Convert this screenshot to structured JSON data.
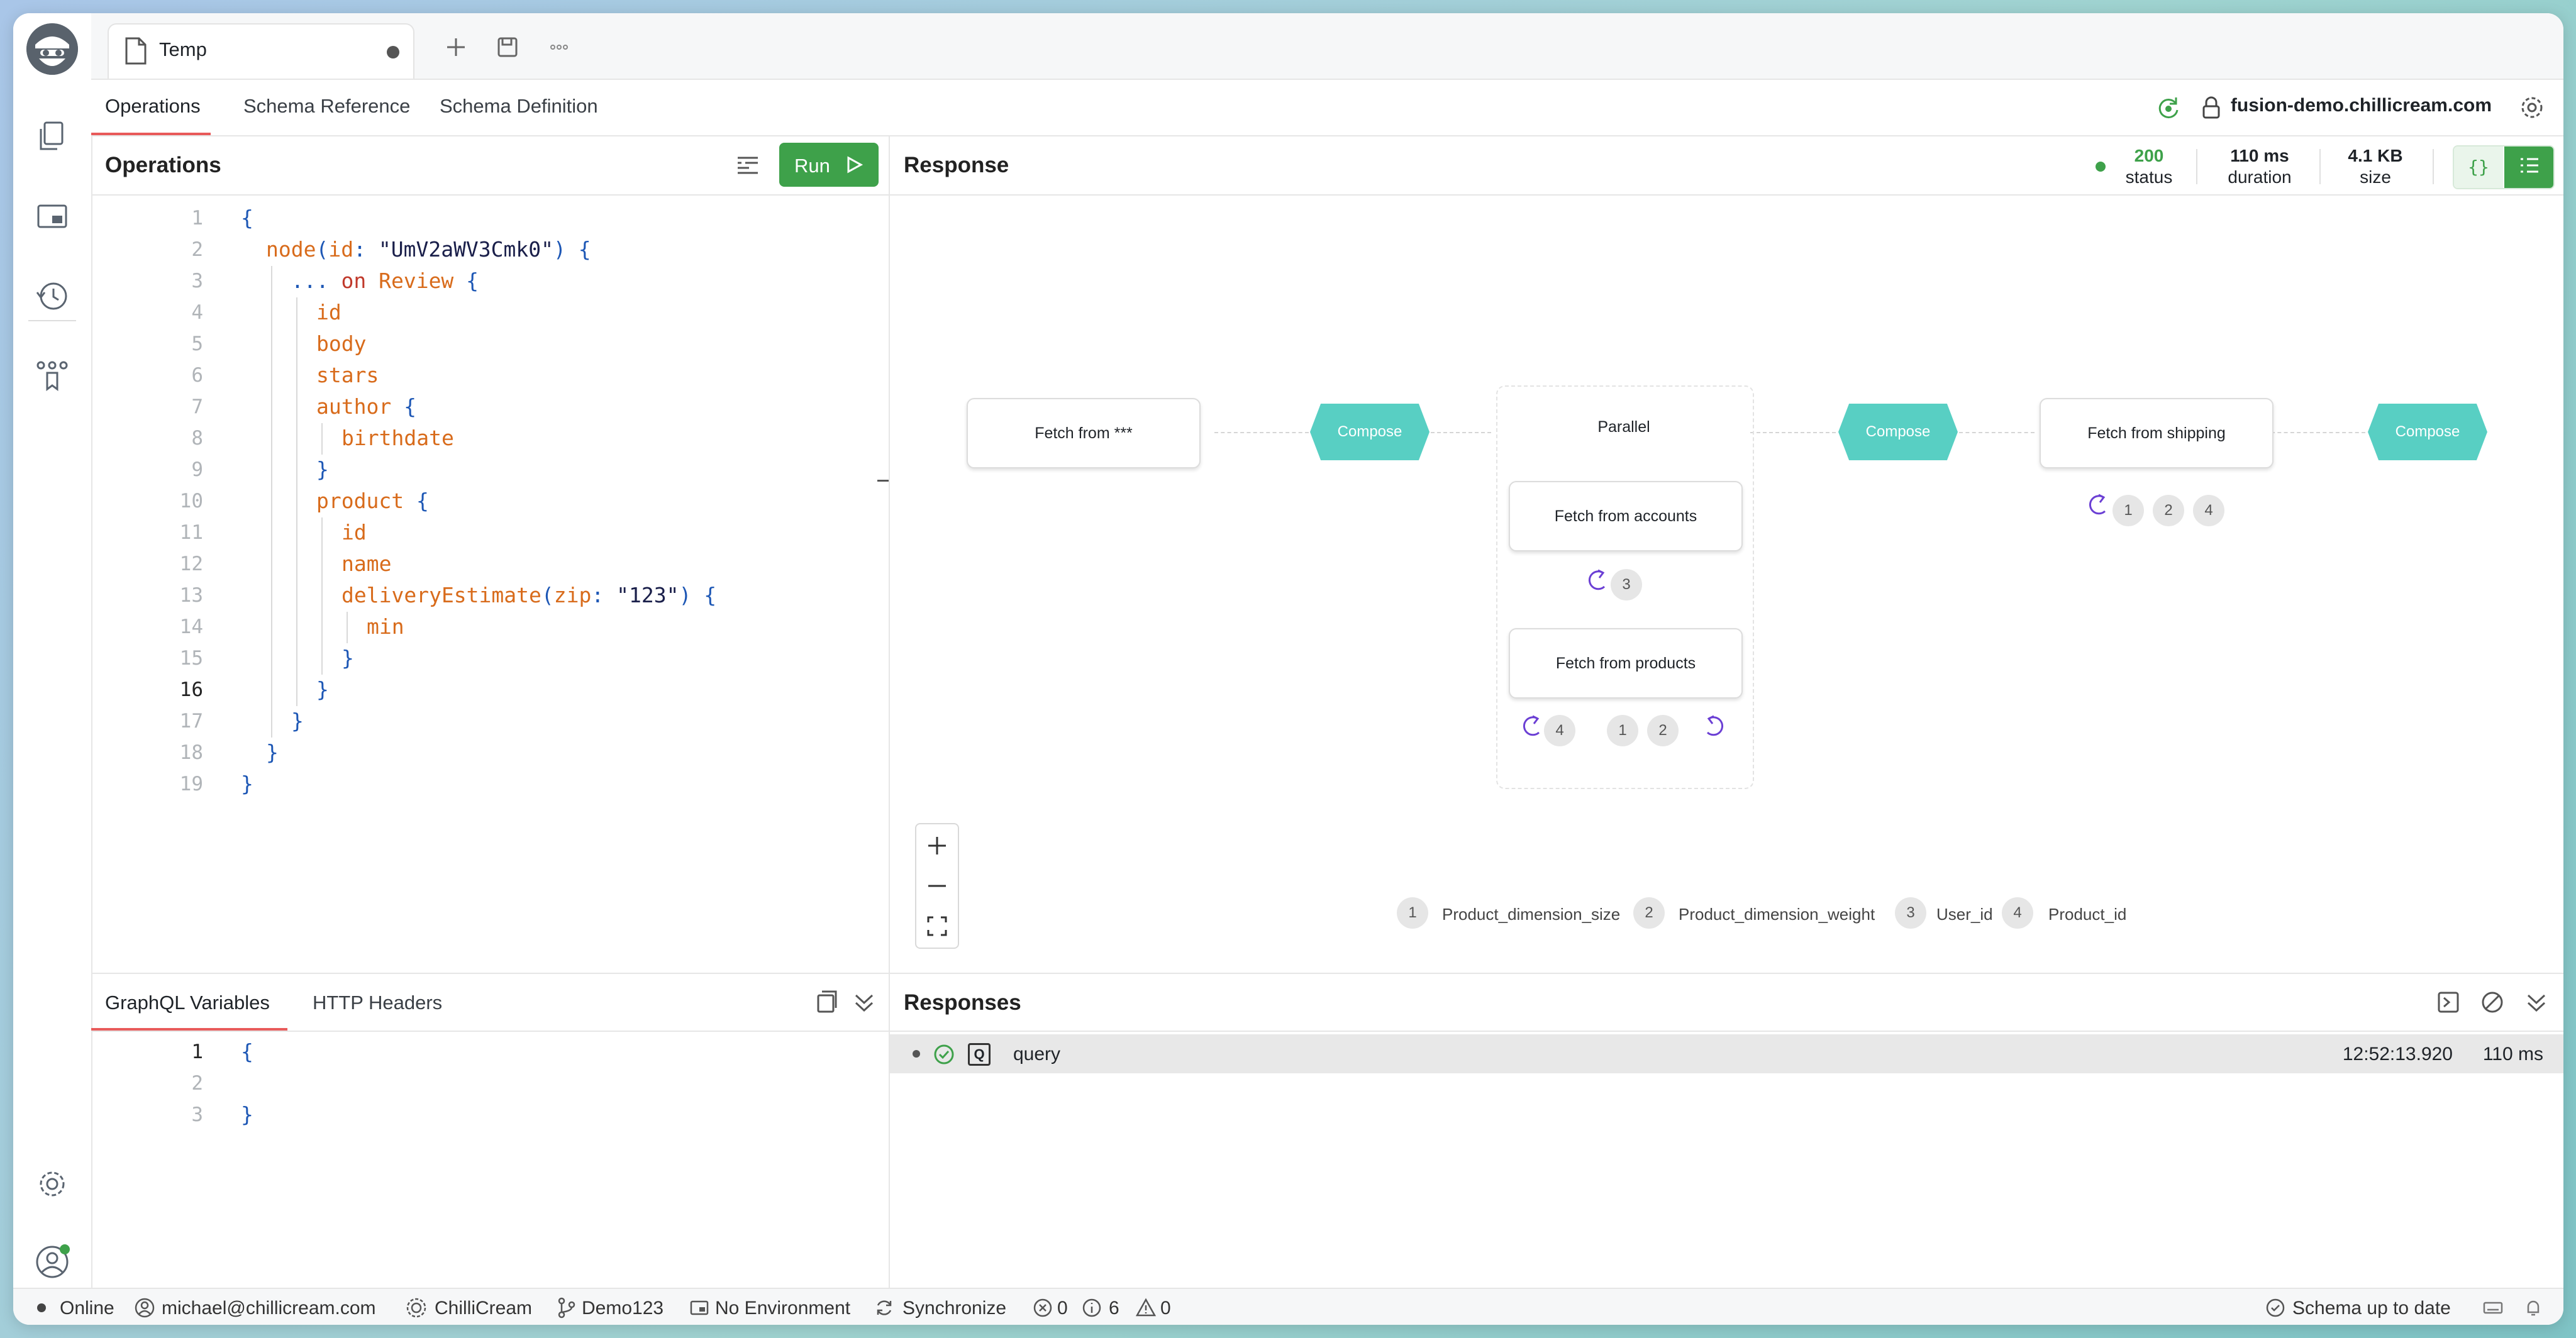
{
  "colors": {
    "accent": "#3ea14a",
    "tab_underline": "#e85a5a",
    "compose": "#58cfc3",
    "keyword_blue": "#1d57b5",
    "field_orange": "#d86b1b",
    "arrow_purple": "#6b3fd4"
  },
  "tab": {
    "title": "Temp"
  },
  "subtabs": [
    "Operations",
    "Schema Reference",
    "Schema Definition"
  ],
  "endpoint": "fusion-demo.chillicream.com",
  "operations": {
    "title": "Operations",
    "run_label": "Run",
    "lines": [
      {
        "n": "1",
        "i": 0,
        "parts": [
          [
            "{",
            "br"
          ]
        ]
      },
      {
        "n": "2",
        "i": 1,
        "parts": [
          [
            "node",
            "fn"
          ],
          [
            "(",
            "br"
          ],
          [
            "id",
            "fn"
          ],
          [
            ": ",
            "br"
          ],
          [
            "\"UmV2aWV3Cmk0\"",
            "str"
          ],
          [
            ") {",
            "br"
          ]
        ]
      },
      {
        "n": "3",
        "i": 2,
        "parts": [
          [
            "... ",
            "br"
          ],
          [
            "on ",
            "kw"
          ],
          [
            "Review ",
            "ty"
          ],
          [
            "{",
            "br"
          ]
        ]
      },
      {
        "n": "4",
        "i": 3,
        "parts": [
          [
            "id",
            "fn"
          ]
        ]
      },
      {
        "n": "5",
        "i": 3,
        "parts": [
          [
            "body",
            "fn"
          ]
        ]
      },
      {
        "n": "6",
        "i": 3,
        "parts": [
          [
            "stars",
            "fn"
          ]
        ]
      },
      {
        "n": "7",
        "i": 3,
        "parts": [
          [
            "author ",
            "fn"
          ],
          [
            "{",
            "br"
          ]
        ]
      },
      {
        "n": "8",
        "i": 4,
        "parts": [
          [
            "birthdate",
            "fn"
          ]
        ]
      },
      {
        "n": "9",
        "i": 3,
        "parts": [
          [
            "}",
            "br"
          ]
        ]
      },
      {
        "n": "10",
        "i": 3,
        "parts": [
          [
            "product ",
            "fn"
          ],
          [
            "{",
            "br"
          ]
        ]
      },
      {
        "n": "11",
        "i": 4,
        "parts": [
          [
            "id",
            "fn"
          ]
        ]
      },
      {
        "n": "12",
        "i": 4,
        "parts": [
          [
            "name",
            "fn"
          ]
        ]
      },
      {
        "n": "13",
        "i": 4,
        "parts": [
          [
            "deliveryEstimate",
            "fn"
          ],
          [
            "(",
            "br"
          ],
          [
            "zip",
            "fn"
          ],
          [
            ": ",
            "br"
          ],
          [
            "\"123\"",
            "str"
          ],
          [
            ") {",
            "br"
          ]
        ]
      },
      {
        "n": "14",
        "i": 5,
        "parts": [
          [
            "min",
            "fn"
          ]
        ]
      },
      {
        "n": "15",
        "i": 4,
        "parts": [
          [
            "}",
            "br"
          ]
        ]
      },
      {
        "n": "16",
        "i": 3,
        "parts": [
          [
            "}",
            "br"
          ]
        ]
      },
      {
        "n": "17",
        "i": 2,
        "parts": [
          [
            "}",
            "br"
          ]
        ]
      },
      {
        "n": "18",
        "i": 1,
        "parts": [
          [
            "}",
            "br"
          ]
        ]
      },
      {
        "n": "19",
        "i": 0,
        "parts": [
          [
            "}",
            "br"
          ]
        ]
      }
    ],
    "current_line": "16"
  },
  "variables": {
    "tabs": [
      "GraphQL Variables",
      "HTTP Headers"
    ],
    "lines": [
      {
        "n": "1",
        "text": "{"
      },
      {
        "n": "2",
        "text": ""
      },
      {
        "n": "3",
        "text": "}"
      }
    ]
  },
  "response": {
    "title": "Response",
    "status": {
      "value": "200",
      "label": "status"
    },
    "duration": {
      "value": "110 ms",
      "label": "duration"
    },
    "size": {
      "value": "4.1 KB",
      "label": "size"
    }
  },
  "plan": {
    "fetch_root": "Fetch from ***",
    "compose": "Compose",
    "parallel": "Parallel",
    "fetch_accounts": "Fetch from accounts",
    "fetch_products": "Fetch from products",
    "fetch_shipping": "Fetch from shipping",
    "badges": {
      "accounts": [
        "3"
      ],
      "products_left": [
        "4"
      ],
      "products_right": [
        "1",
        "2"
      ],
      "shipping": [
        "1",
        "2",
        "4"
      ]
    },
    "legend": [
      {
        "num": "1",
        "label": "Product_dimension_size"
      },
      {
        "num": "2",
        "label": "Product_dimension_weight"
      },
      {
        "num": "3",
        "label": "User_id"
      },
      {
        "num": "4",
        "label": "Product_id"
      }
    ]
  },
  "responses": {
    "title": "Responses",
    "rows": [
      {
        "type": "Q",
        "name": "query",
        "time": "12:52:13.920",
        "duration": "110 ms"
      }
    ]
  },
  "statusbar": {
    "online": "Online",
    "user": "michael@chillicream.com",
    "org": "ChilliCream",
    "branch": "Demo123",
    "env": "No Environment",
    "sync": "Synchronize",
    "errors": "0",
    "infos": "6",
    "warnings": "0",
    "schema": "Schema up to date"
  }
}
